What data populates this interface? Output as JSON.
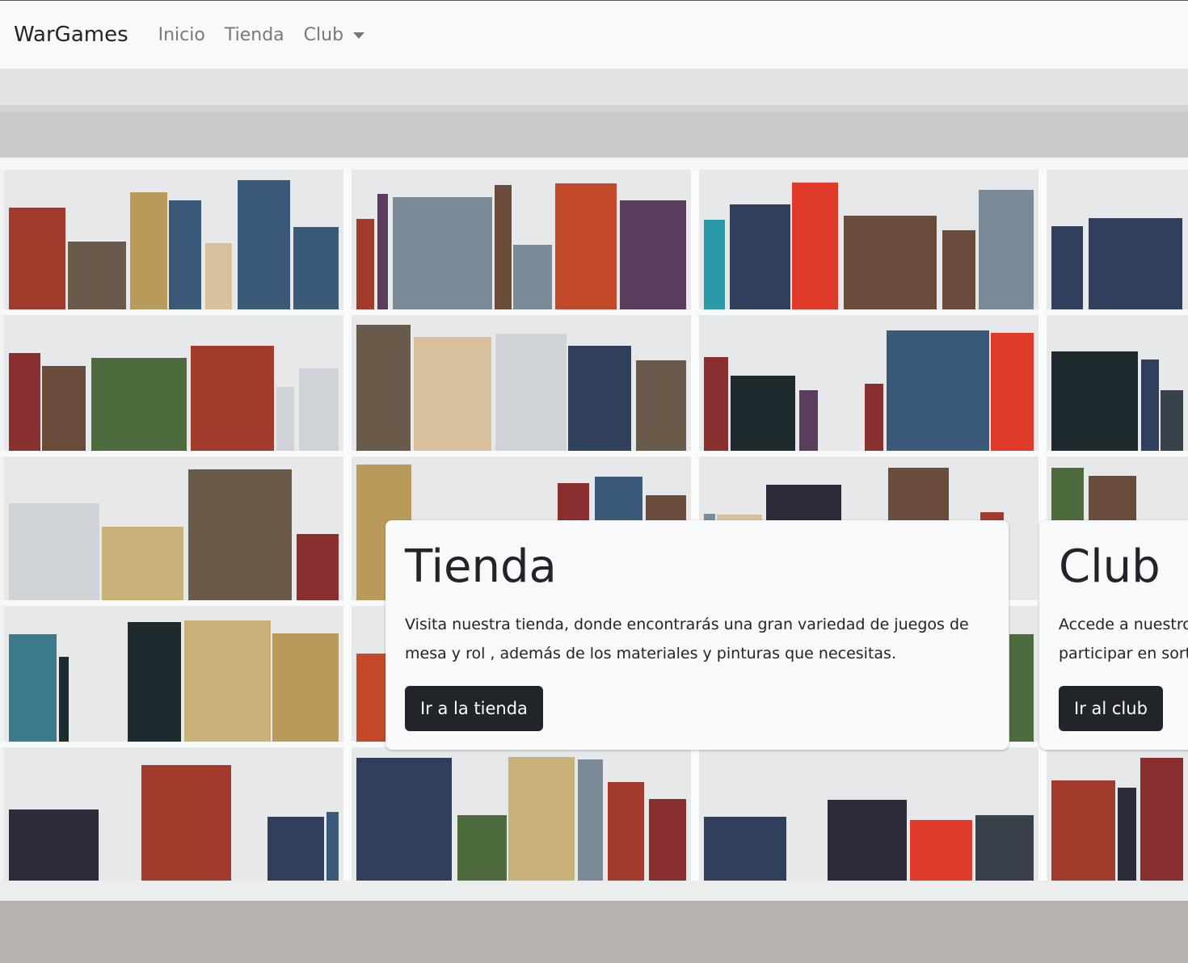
{
  "navbar": {
    "brand": "WarGames",
    "links": [
      {
        "label": "Inicio"
      },
      {
        "label": "Tienda"
      },
      {
        "label": "Club"
      }
    ]
  },
  "hero": {
    "image_subject": "shelves of board games"
  },
  "cards": {
    "tienda": {
      "title": "Tienda",
      "text": "Visita nuestra tienda, donde encontrarás una gran variedad de juegos de mesa y rol , además de los materiales y pinturas que necesitas.",
      "button": "Ir a la tienda"
    },
    "club": {
      "title": "Club",
      "text_line1": "Accede a nuestro",
      "text_line2": "participar en sorte",
      "button": "Ir al club"
    }
  },
  "colors": {
    "navbar_bg": "#f8f9fa",
    "card_bg": "#f8f9fa",
    "button_bg": "#212529",
    "text": "#212529",
    "nav_link": "#76797d"
  }
}
